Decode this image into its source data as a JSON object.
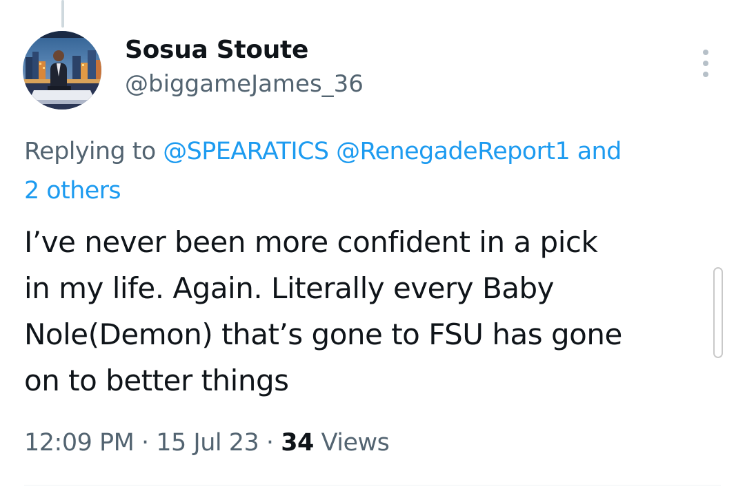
{
  "author": {
    "display_name": "Sosua Stoute",
    "handle": "@biggameJames_36",
    "avatar_icon": "profile-photo"
  },
  "more_icon": "more-vertical-icon",
  "reply": {
    "prefix": "Replying to",
    "mention_1": "@SPEARATICS",
    "mention_2": "@RenegadeReport1",
    "connector": "and",
    "others": "2 others"
  },
  "tweet": {
    "line_1": "I’ve never been more confident in a pick",
    "line_2": "in my life. Again. Literally every Baby",
    "line_3": "Nole(Demon) that’s gone to FSU has gone",
    "line_4": "on to better things"
  },
  "meta": {
    "time": "12:09 PM",
    "separator": "·",
    "date": "15 Jul 23",
    "views_count": "34",
    "views_label": "Views"
  },
  "colors": {
    "link": "#1d9bf0",
    "secondary_text": "#536471",
    "primary_text": "#0f1419"
  }
}
